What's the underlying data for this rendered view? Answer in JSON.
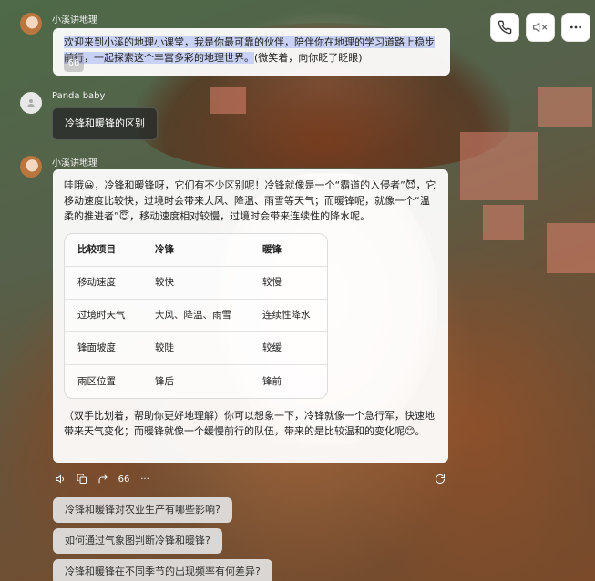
{
  "controls": {
    "call_icon": "phone-icon",
    "mute_icon": "speaker-muted-icon",
    "more_icon": "more-dots-icon"
  },
  "messages": [
    {
      "sender": "小溪讲地理",
      "text_highlighted": "欢迎来到小溪的地理小课堂，我是你最可靠的伙伴，陪伴你在地理的学习道路上稳步前行，一起探索这个丰富多彩的地理世界。",
      "text_plain": "(微笑着，向你眨了眨眼)",
      "quote_chip": "66"
    },
    {
      "sender": "Panda baby",
      "text": "冷锋和暖锋的区别"
    },
    {
      "sender": "小溪讲地理",
      "intro": "哇哦😀，冷锋和暖锋呀，它们有不少区别呢！冷锋就像是一个“霸道的入侵者”😈，它移动速度比较快，过境时会带来大风、降温、雨雪等天气；而暖锋呢，就像一个“温柔的推进者”😇，移动速度相对较慢，过境时会带来连续性的降水呢。",
      "table": {
        "headers": [
          "比较项目",
          "冷锋",
          "暖锋"
        ],
        "rows": [
          [
            "移动速度",
            "较快",
            "较慢"
          ],
          [
            "过境时天气",
            "大风、降温、雨雪",
            "连续性降水"
          ],
          [
            "锋面坡度",
            "较陡",
            "较缓"
          ],
          [
            "雨区位置",
            "锋后",
            "锋前"
          ]
        ]
      },
      "outro": "（双手比划着，帮助你更好地理解）你可以想象一下，冷锋就像一个急行军，快速地带来天气变化；而暖锋就像一个缓慢前行的队伍，带来的是比较温和的变化呢😊。"
    }
  ],
  "actions": {
    "quote_label": "66",
    "more_label": "···"
  },
  "suggestions": [
    "冷锋和暖锋对农业生产有哪些影响?",
    "如何通过气象图判断冷锋和暖锋?",
    "冷锋和暖锋在不同季节的出现频率有何差异?"
  ]
}
